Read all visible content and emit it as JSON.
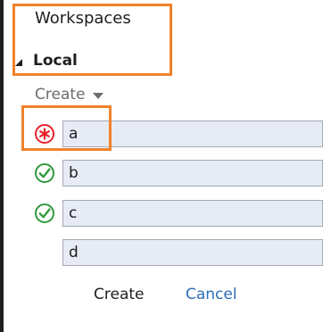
{
  "panel": {
    "title": "Workspaces"
  },
  "section": {
    "label": "Local"
  },
  "create_menu": {
    "label": "Create"
  },
  "rows": [
    {
      "value": "a",
      "status": "error"
    },
    {
      "value": "b",
      "status": "ok"
    },
    {
      "value": "c",
      "status": "ok"
    },
    {
      "value": "d",
      "status": "none"
    }
  ],
  "footer": {
    "create_label": "Create",
    "cancel_label": "Cancel"
  },
  "colors": {
    "error": "#e8202a",
    "ok": "#2e9a3c",
    "highlight": "#f0822b",
    "link": "#2d6eb8",
    "field_bg": "#e7ebf5"
  },
  "icons": {
    "error": "asterisk-circle-icon",
    "ok": "checkmark-circle-icon",
    "expand": "triangle-down-right-icon",
    "dropdown": "caret-down-icon"
  }
}
